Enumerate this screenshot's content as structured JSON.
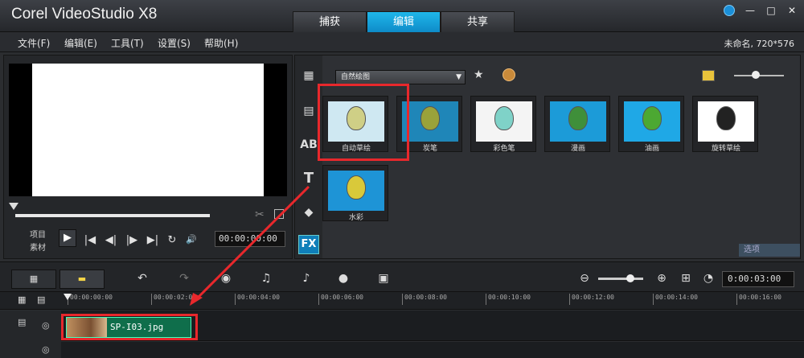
{
  "app": {
    "title": "Corel VideoStudio X8"
  },
  "tabs": [
    {
      "label": "捕获",
      "active": false
    },
    {
      "label": "编辑",
      "active": true
    },
    {
      "label": "共享",
      "active": false
    }
  ],
  "window_controls": {
    "minimize": "—",
    "maximize": "□",
    "close": "✕"
  },
  "menu": [
    "文件(F)",
    "编辑(E)",
    "工具(T)",
    "设置(S)",
    "帮助(H)"
  ],
  "project_info": "未命名, 720*576",
  "preview": {
    "mode_project": "项目",
    "mode_clip": "素材",
    "timecode": "00:00:00:00",
    "controls": {
      "play": "▶",
      "home": "|◀",
      "prev": "◀|",
      "next": "|▶",
      "end": "▶|",
      "repeat": "↻",
      "volume": "🔊"
    }
  },
  "library": {
    "filter_select": "自然绘图",
    "thumbnails": [
      {
        "caption": "自动草绘",
        "style": "sketch"
      },
      {
        "caption": "炭笔",
        "style": "charcoal"
      },
      {
        "caption": "彩色笔",
        "style": "colorpen"
      },
      {
        "caption": "漫画",
        "style": "comic"
      },
      {
        "caption": "油画",
        "style": "oil"
      },
      {
        "caption": "旋转草绘",
        "style": "bw"
      },
      {
        "caption": "水彩",
        "style": "water"
      }
    ],
    "fx_label": "FX",
    "options_label": "选项"
  },
  "timeline": {
    "total_timecode": "0:00:03:00",
    "ruler": [
      "00:00:00:00",
      "00:00:02:00",
      "00:00:04:00",
      "00:00:06:00",
      "00:00:08:00",
      "00:00:10:00",
      "00:00:12:00",
      "00:00:14:00",
      "00:00:16:00"
    ],
    "clip": {
      "name": "SP-I03.jpg"
    }
  },
  "colors": {
    "accent": "#12a6e0",
    "highlight": "#e8282c",
    "clip": "#0f6e4b"
  }
}
